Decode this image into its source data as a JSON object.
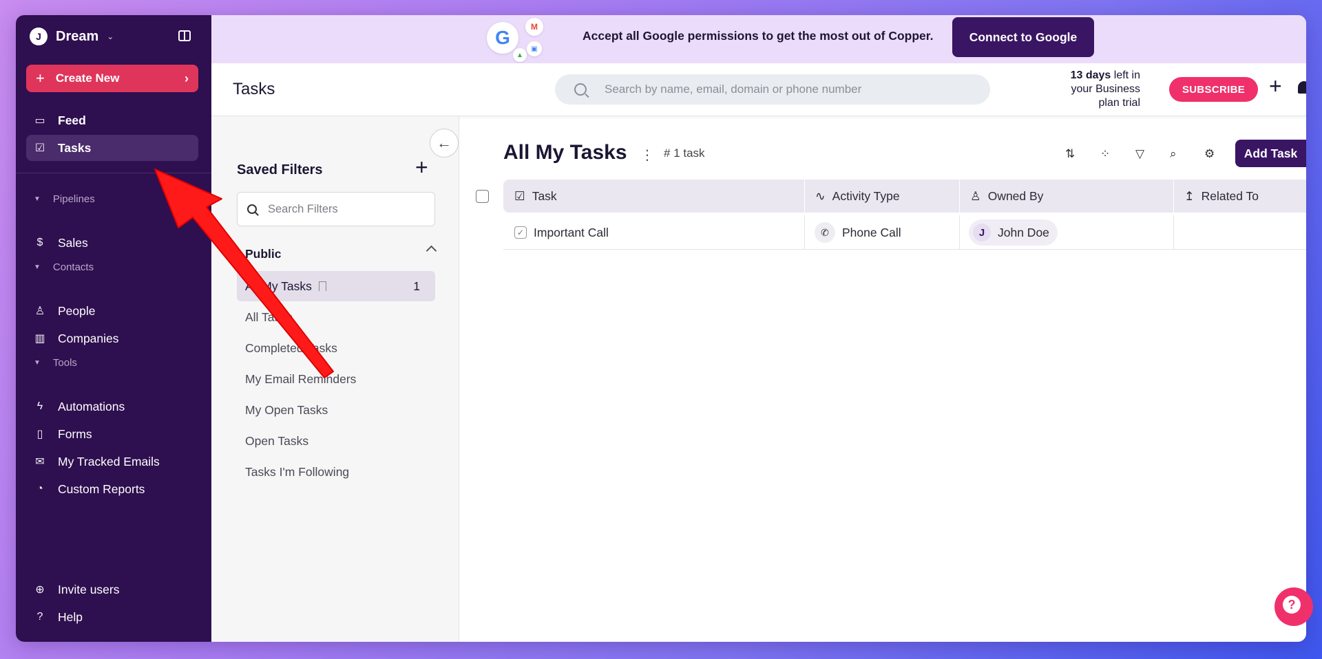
{
  "sidebar": {
    "workspace_initial": "J",
    "workspace_name": "Dream",
    "create_new": "Create New",
    "feed": "Feed",
    "tasks": "Tasks",
    "pipelines_header": "Pipelines",
    "sales": "Sales",
    "contacts_header": "Contacts",
    "people": "People",
    "companies": "Companies",
    "tools_header": "Tools",
    "automations": "Automations",
    "forms": "Forms",
    "tracked_emails": "My Tracked Emails",
    "custom_reports": "Custom Reports",
    "invite_users": "Invite users",
    "help": "Help"
  },
  "banner": {
    "text": "Accept all Google permissions to get the most out of Copper.",
    "connect_label": "Connect to Google"
  },
  "header": {
    "title": "Tasks",
    "search_placeholder": "Search by name, email, domain or phone number",
    "trial_bold": "13 days",
    "trial_rest": " left in your Business plan trial",
    "subscribe": "SUBSCRIBE"
  },
  "filters": {
    "title": "Saved Filters",
    "search_placeholder": "Search Filters",
    "public_header": "Public",
    "items": [
      {
        "label": "All My Tasks",
        "count": "1"
      },
      {
        "label": "All Tasks"
      },
      {
        "label": "Completed Tasks"
      },
      {
        "label": "My Email Reminders"
      },
      {
        "label": "My Open Tasks"
      },
      {
        "label": "Open Tasks"
      },
      {
        "label": "Tasks I'm Following"
      }
    ]
  },
  "main": {
    "title": "All My Tasks",
    "task_count": "1 task",
    "add_task": "Add Task",
    "columns": [
      "Task",
      "Activity Type",
      "Owned By",
      "Related To"
    ],
    "rows": [
      {
        "task": "Important Call",
        "activity": "Phone Call",
        "owner_initial": "J",
        "owner": "John Doe",
        "related": ""
      }
    ]
  },
  "colors": {
    "sidebar_bg": "#2e0f4f",
    "accent_red": "#e0355b",
    "subscribe_pink": "#f0306a",
    "primary_button": "#3a1563",
    "annotation_arrow": "#ff1a1a"
  }
}
